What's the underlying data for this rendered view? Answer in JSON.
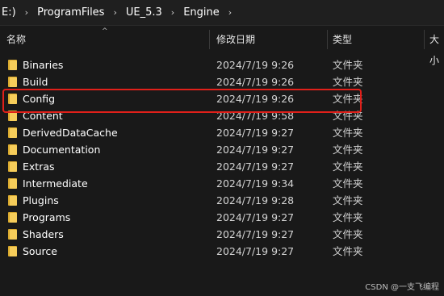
{
  "address": {
    "crumbs": [
      "E:)",
      "ProgramFiles",
      "UE_5.3",
      "Engine"
    ],
    "separator": "›"
  },
  "columns": {
    "name": "名称",
    "date": "修改日期",
    "type": "类型",
    "size": "大小",
    "sort_arrow": "^"
  },
  "files": [
    {
      "name": "Binaries",
      "date": "2024/7/19 9:26",
      "type": "文件夹"
    },
    {
      "name": "Build",
      "date": "2024/7/19 9:26",
      "type": "文件夹"
    },
    {
      "name": "Config",
      "date": "2024/7/19 9:26",
      "type": "文件夹"
    },
    {
      "name": "Content",
      "date": "2024/7/19 9:58",
      "type": "文件夹"
    },
    {
      "name": "DerivedDataCache",
      "date": "2024/7/19 9:27",
      "type": "文件夹"
    },
    {
      "name": "Documentation",
      "date": "2024/7/19 9:27",
      "type": "文件夹"
    },
    {
      "name": "Extras",
      "date": "2024/7/19 9:27",
      "type": "文件夹"
    },
    {
      "name": "Intermediate",
      "date": "2024/7/19 9:34",
      "type": "文件夹"
    },
    {
      "name": "Plugins",
      "date": "2024/7/19 9:28",
      "type": "文件夹"
    },
    {
      "name": "Programs",
      "date": "2024/7/19 9:27",
      "type": "文件夹"
    },
    {
      "name": "Shaders",
      "date": "2024/7/19 9:27",
      "type": "文件夹"
    },
    {
      "name": "Source",
      "date": "2024/7/19 9:27",
      "type": "文件夹"
    }
  ],
  "watermark": "CSDN @一支飞编程",
  "colors": {
    "background": "#191919",
    "folder": "#f6cd5a",
    "highlight": "#e0201a"
  }
}
